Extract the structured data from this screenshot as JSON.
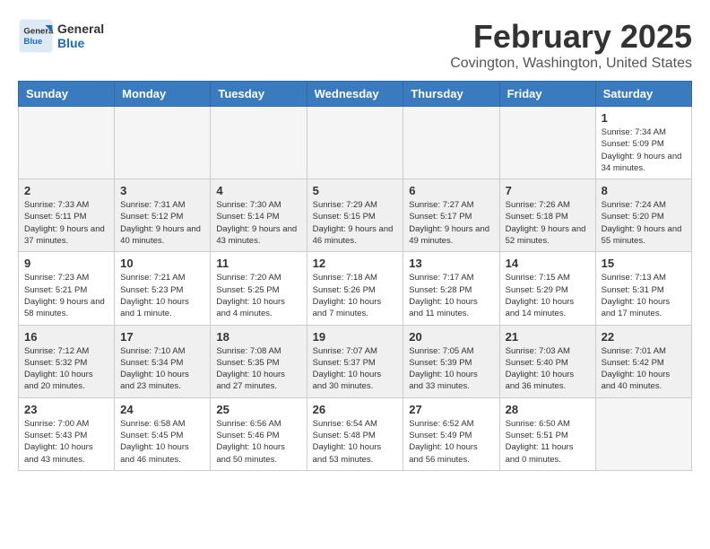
{
  "header": {
    "logo_line1": "General",
    "logo_line2": "Blue",
    "month_title": "February 2025",
    "location": "Covington, Washington, United States"
  },
  "weekdays": [
    "Sunday",
    "Monday",
    "Tuesday",
    "Wednesday",
    "Thursday",
    "Friday",
    "Saturday"
  ],
  "weeks": [
    [
      {
        "day": "",
        "info": ""
      },
      {
        "day": "",
        "info": ""
      },
      {
        "day": "",
        "info": ""
      },
      {
        "day": "",
        "info": ""
      },
      {
        "day": "",
        "info": ""
      },
      {
        "day": "",
        "info": ""
      },
      {
        "day": "1",
        "info": "Sunrise: 7:34 AM\nSunset: 5:09 PM\nDaylight: 9 hours and 34 minutes."
      }
    ],
    [
      {
        "day": "2",
        "info": "Sunrise: 7:33 AM\nSunset: 5:11 PM\nDaylight: 9 hours and 37 minutes."
      },
      {
        "day": "3",
        "info": "Sunrise: 7:31 AM\nSunset: 5:12 PM\nDaylight: 9 hours and 40 minutes."
      },
      {
        "day": "4",
        "info": "Sunrise: 7:30 AM\nSunset: 5:14 PM\nDaylight: 9 hours and 43 minutes."
      },
      {
        "day": "5",
        "info": "Sunrise: 7:29 AM\nSunset: 5:15 PM\nDaylight: 9 hours and 46 minutes."
      },
      {
        "day": "6",
        "info": "Sunrise: 7:27 AM\nSunset: 5:17 PM\nDaylight: 9 hours and 49 minutes."
      },
      {
        "day": "7",
        "info": "Sunrise: 7:26 AM\nSunset: 5:18 PM\nDaylight: 9 hours and 52 minutes."
      },
      {
        "day": "8",
        "info": "Sunrise: 7:24 AM\nSunset: 5:20 PM\nDaylight: 9 hours and 55 minutes."
      }
    ],
    [
      {
        "day": "9",
        "info": "Sunrise: 7:23 AM\nSunset: 5:21 PM\nDaylight: 9 hours and 58 minutes."
      },
      {
        "day": "10",
        "info": "Sunrise: 7:21 AM\nSunset: 5:23 PM\nDaylight: 10 hours and 1 minute."
      },
      {
        "day": "11",
        "info": "Sunrise: 7:20 AM\nSunset: 5:25 PM\nDaylight: 10 hours and 4 minutes."
      },
      {
        "day": "12",
        "info": "Sunrise: 7:18 AM\nSunset: 5:26 PM\nDaylight: 10 hours and 7 minutes."
      },
      {
        "day": "13",
        "info": "Sunrise: 7:17 AM\nSunset: 5:28 PM\nDaylight: 10 hours and 11 minutes."
      },
      {
        "day": "14",
        "info": "Sunrise: 7:15 AM\nSunset: 5:29 PM\nDaylight: 10 hours and 14 minutes."
      },
      {
        "day": "15",
        "info": "Sunrise: 7:13 AM\nSunset: 5:31 PM\nDaylight: 10 hours and 17 minutes."
      }
    ],
    [
      {
        "day": "16",
        "info": "Sunrise: 7:12 AM\nSunset: 5:32 PM\nDaylight: 10 hours and 20 minutes."
      },
      {
        "day": "17",
        "info": "Sunrise: 7:10 AM\nSunset: 5:34 PM\nDaylight: 10 hours and 23 minutes."
      },
      {
        "day": "18",
        "info": "Sunrise: 7:08 AM\nSunset: 5:35 PM\nDaylight: 10 hours and 27 minutes."
      },
      {
        "day": "19",
        "info": "Sunrise: 7:07 AM\nSunset: 5:37 PM\nDaylight: 10 hours and 30 minutes."
      },
      {
        "day": "20",
        "info": "Sunrise: 7:05 AM\nSunset: 5:39 PM\nDaylight: 10 hours and 33 minutes."
      },
      {
        "day": "21",
        "info": "Sunrise: 7:03 AM\nSunset: 5:40 PM\nDaylight: 10 hours and 36 minutes."
      },
      {
        "day": "22",
        "info": "Sunrise: 7:01 AM\nSunset: 5:42 PM\nDaylight: 10 hours and 40 minutes."
      }
    ],
    [
      {
        "day": "23",
        "info": "Sunrise: 7:00 AM\nSunset: 5:43 PM\nDaylight: 10 hours and 43 minutes."
      },
      {
        "day": "24",
        "info": "Sunrise: 6:58 AM\nSunset: 5:45 PM\nDaylight: 10 hours and 46 minutes."
      },
      {
        "day": "25",
        "info": "Sunrise: 6:56 AM\nSunset: 5:46 PM\nDaylight: 10 hours and 50 minutes."
      },
      {
        "day": "26",
        "info": "Sunrise: 6:54 AM\nSunset: 5:48 PM\nDaylight: 10 hours and 53 minutes."
      },
      {
        "day": "27",
        "info": "Sunrise: 6:52 AM\nSunset: 5:49 PM\nDaylight: 10 hours and 56 minutes."
      },
      {
        "day": "28",
        "info": "Sunrise: 6:50 AM\nSunset: 5:51 PM\nDaylight: 11 hours and 0 minutes."
      },
      {
        "day": "",
        "info": ""
      }
    ]
  ]
}
